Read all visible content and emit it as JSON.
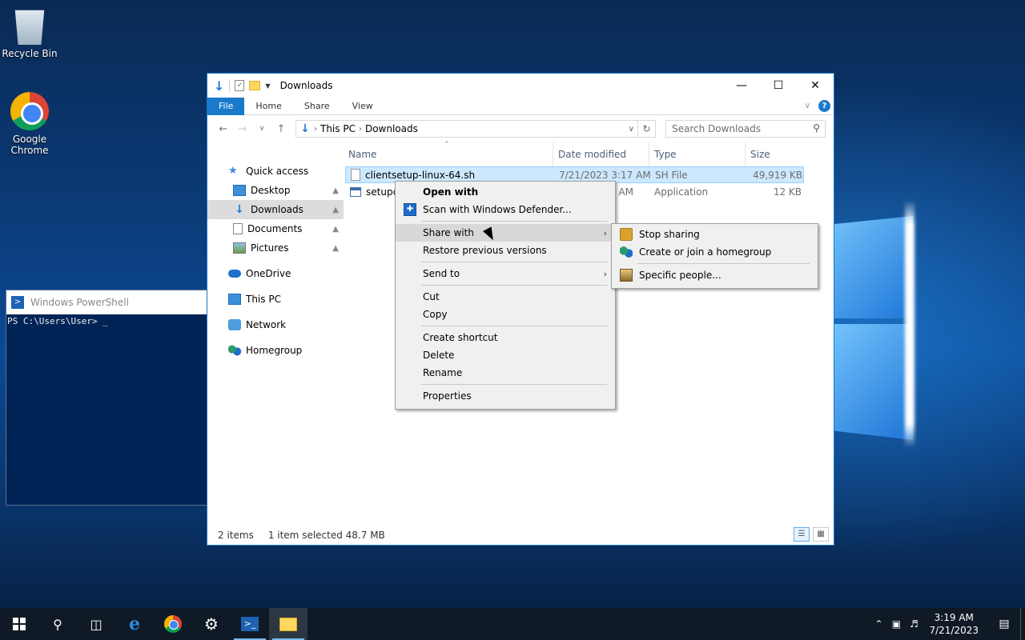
{
  "desktop": {
    "icons": [
      {
        "label": "Recycle Bin",
        "icon": "recycle-bin-icon"
      },
      {
        "label": "Google Chrome",
        "icon": "chrome-icon"
      }
    ]
  },
  "powershell": {
    "title": "Windows PowerShell",
    "prompt": "PS C:\\Users\\User> _"
  },
  "explorer": {
    "title": "Downloads",
    "ribbon_tabs": [
      "File",
      "Home",
      "Share",
      "View"
    ],
    "address": {
      "crumbs": [
        "This PC",
        "Downloads"
      ]
    },
    "search_placeholder": "Search Downloads",
    "nav": [
      {
        "label": "Quick access"
      },
      {
        "label": "Desktop"
      },
      {
        "label": "Downloads"
      },
      {
        "label": "Documents"
      },
      {
        "label": "Pictures"
      },
      {
        "label": "OneDrive"
      },
      {
        "label": "This PC"
      },
      {
        "label": "Network"
      },
      {
        "label": "Homegroup"
      }
    ],
    "columns": {
      "name": "Name",
      "date": "Date modified",
      "type": "Type",
      "size": "Size"
    },
    "files": [
      {
        "name": "clientsetup-linux-64.sh",
        "date": "7/21/2023 3:17 AM",
        "type": "SH File",
        "size": "49,919 KB"
      },
      {
        "name": "setupcl",
        "date": "5 AM",
        "type": "Application",
        "size": "12 KB"
      }
    ],
    "status": {
      "items": "2 items",
      "selected": "1 item selected  48.7 MB"
    }
  },
  "context_menu": {
    "items": {
      "open_with": "Open with",
      "scan": "Scan with Windows Defender...",
      "share_with": "Share with",
      "restore": "Restore previous versions",
      "send_to": "Send to",
      "cut": "Cut",
      "copy": "Copy",
      "create_shortcut": "Create shortcut",
      "delete": "Delete",
      "rename": "Rename",
      "properties": "Properties"
    },
    "submenu": {
      "stop_sharing": "Stop sharing",
      "homegroup": "Create or join a homegroup",
      "specific_people": "Specific people..."
    }
  },
  "taskbar": {
    "time": "3:19 AM",
    "date": "7/21/2023"
  }
}
